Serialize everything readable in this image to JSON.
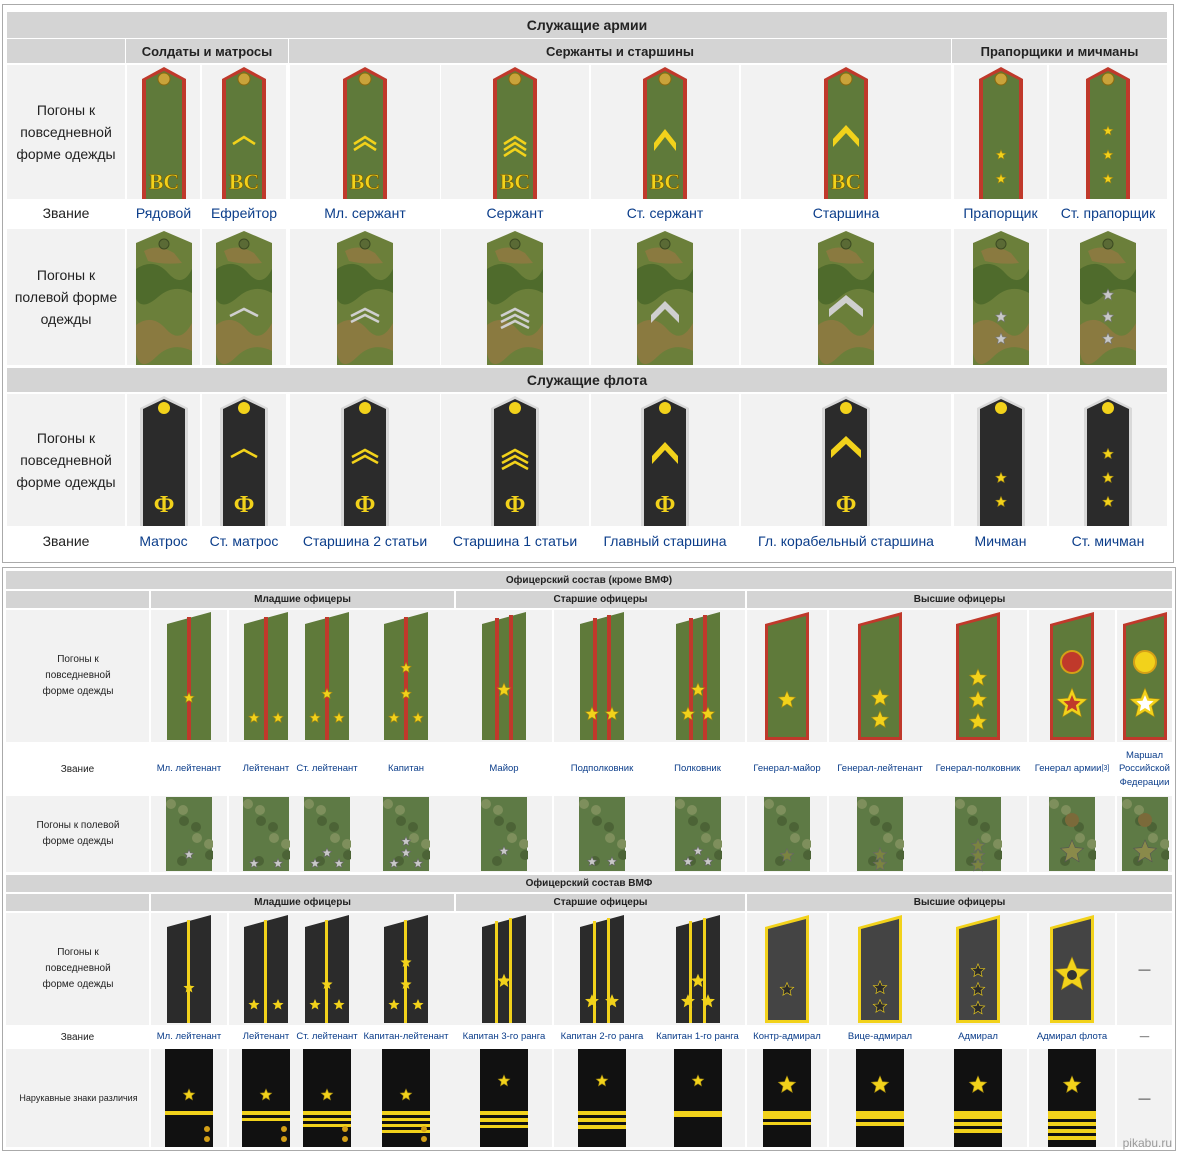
{
  "army": {
    "title": "Служащие армии",
    "groups": [
      "Солдаты и матросы",
      "Сержанты и старшины",
      "Прапорщики и мичманы"
    ],
    "row_daily_label": "Погоны к повседневной форме одежды",
    "row_field_label": "Погоны к полевой форме одежды",
    "rank_label": "Звание",
    "ranks": [
      "Рядовой",
      "Ефрейтор",
      "Мл. сержант",
      "Сержант",
      "Ст. сержант",
      "Старшина",
      "Прапорщик",
      "Ст. прапорщик"
    ],
    "emblem": "ВС"
  },
  "fleet": {
    "title": "Служащие флота",
    "row_daily_label": "Погоны к повседневной форме одежды",
    "rank_label": "Звание",
    "ranks": [
      "Матрос",
      "Ст. матрос",
      "Старшина 2 статьи",
      "Старшина 1 статьи",
      "Главный старшина",
      "Гл. корабельный старшина",
      "Мичман",
      "Ст. мичман"
    ],
    "emblem": "Ф"
  },
  "officers_army": {
    "title": "Офицерский состав (кроме ВМФ)",
    "groups": [
      "Младшие офицеры",
      "Старшие офицеры",
      "Высшие офицеры"
    ],
    "row_daily_label": "Погоны к повседневной форме одежды",
    "row_field_label": "Погоны к полевой форме одежды",
    "rank_label": "Звание",
    "ranks": [
      "Мл. лейтенант",
      "Лейтенант",
      "Ст. лейтенант",
      "Капитан",
      "Майор",
      "Подполковник",
      "Полковник",
      "Генерал-майор",
      "Генерал-лейтенант",
      "Генерал-полковник",
      "Генерал армии",
      "Маршал Российской Федерации"
    ],
    "ref": "[3]"
  },
  "officers_navy": {
    "title": "Офицерский состав ВМФ",
    "groups": [
      "Младшие офицеры",
      "Старшие офицеры",
      "Высшие офицеры"
    ],
    "row_daily_label": "Погоны к повседневной форме одежды",
    "rank_label": "Звание",
    "sleeve_label": "Нарукавные знаки различия",
    "ranks": [
      "Мл. лейтенант",
      "Лейтенант",
      "Ст. лейтенант",
      "Капитан-лейтенант",
      "Капитан 3-го ранга",
      "Капитан 2-го ранга",
      "Капитан 1-го ранга",
      "Контр-адмирал",
      "Вице-адмирал",
      "Адмирал",
      "Адмирал флота",
      "—"
    ],
    "dash": "—"
  },
  "watermark": "pikabu.ru",
  "colors": {
    "header": "#d4d4d4",
    "cell": "#f2f2f2",
    "link": "#0b3d8a",
    "olive": "#5f7a3a",
    "red": "#c0392b",
    "gold": "#f2d21b",
    "navy": "#2a2a2a"
  }
}
